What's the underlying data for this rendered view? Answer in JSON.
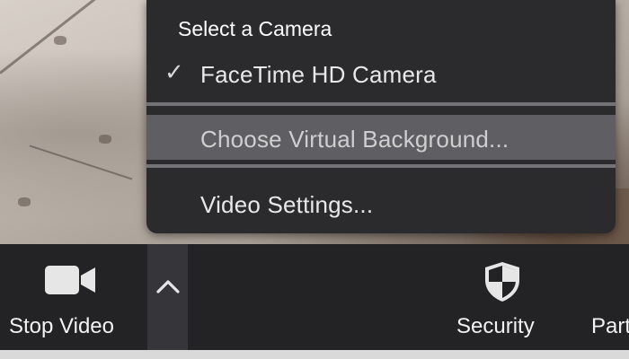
{
  "camera_menu": {
    "header": "Select a Camera",
    "items": [
      {
        "label": "FaceTime HD Camera",
        "checked": true
      },
      {
        "label": "Choose Virtual Background...",
        "highlighted": true
      },
      {
        "label": "Video Settings..."
      }
    ],
    "check_glyph": "✓"
  },
  "toolbar": {
    "stop_video": {
      "label": "Stop Video",
      "icon": "video-camera-icon"
    },
    "video_options": {
      "icon": "chevron-up-icon"
    },
    "security": {
      "label": "Security",
      "icon": "shield-icon"
    },
    "participants": {
      "label": "Participants"
    }
  },
  "colors": {
    "toolbar_bg": "#232325",
    "menu_bg": "#2b2b2e",
    "menu_highlight": "#5f5f63",
    "separator": "#737377",
    "text": "#f2f2f2"
  }
}
